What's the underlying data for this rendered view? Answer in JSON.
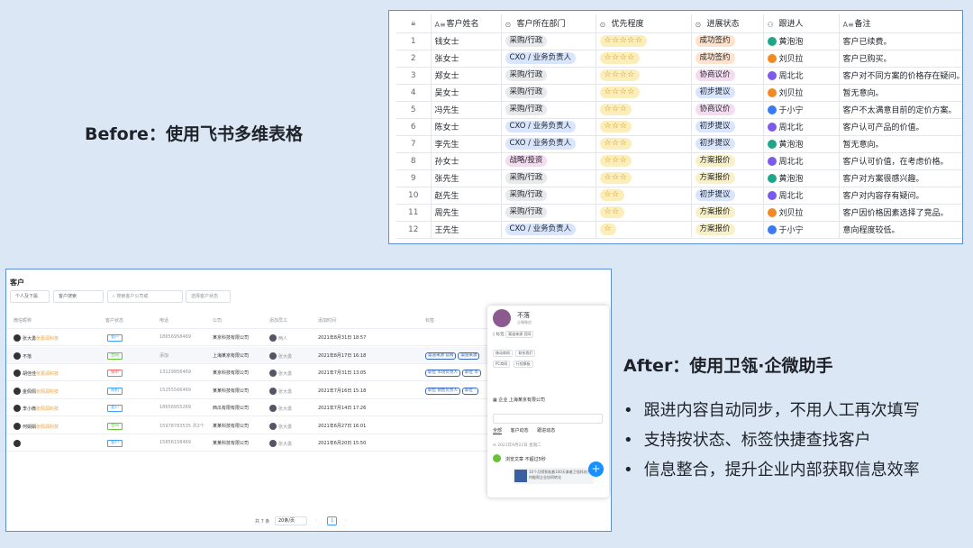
{
  "before": {
    "label": "Before：使用飞书多维表格",
    "columns": [
      "客户姓名",
      "客户所在部门",
      "优先程度",
      "进展状态",
      "跟进人",
      "备注"
    ],
    "rows": [
      {
        "n": "1",
        "name": "钱女士",
        "dept": "采购/行政",
        "stars": "☆☆☆☆☆",
        "status": "成功签约",
        "owner": "黄泡泡",
        "note": "客户已续费。"
      },
      {
        "n": "2",
        "name": "张女士",
        "dept": "CXO / 业务负责人",
        "stars": "☆☆☆☆",
        "status": "成功签约",
        "owner": "刘贝拉",
        "note": "客户已购买。"
      },
      {
        "n": "3",
        "name": "郑女士",
        "dept": "采购/行政",
        "stars": "☆☆☆☆",
        "status": "协商议价",
        "owner": "周北北",
        "note": "客户对不同方案的价格存在疑问。"
      },
      {
        "n": "4",
        "name": "吴女士",
        "dept": "采购/行政",
        "stars": "☆☆☆☆",
        "status": "初步提议",
        "owner": "刘贝拉",
        "note": "暂无意向。"
      },
      {
        "n": "5",
        "name": "冯先生",
        "dept": "采购/行政",
        "stars": "☆☆☆",
        "status": "协商议价",
        "owner": "于小宁",
        "note": "客户不太满意目前的定价方案。"
      },
      {
        "n": "6",
        "name": "陈女士",
        "dept": "CXO / 业务负责人",
        "stars": "☆☆☆",
        "status": "初步提议",
        "owner": "周北北",
        "note": "客户认可产品的价值。"
      },
      {
        "n": "7",
        "name": "李先生",
        "dept": "CXO / 业务负责人",
        "stars": "☆☆☆",
        "status": "初步提议",
        "owner": "黄泡泡",
        "note": "暂无意向。"
      },
      {
        "n": "8",
        "name": "孙女士",
        "dept": "战略/投资",
        "stars": "☆☆☆",
        "status": "方案报价",
        "owner": "周北北",
        "note": "客户认可价值，在考虑价格。"
      },
      {
        "n": "9",
        "name": "张先生",
        "dept": "采购/行政",
        "stars": "☆☆☆",
        "status": "方案报价",
        "owner": "黄泡泡",
        "note": "客户对方案很感兴趣。"
      },
      {
        "n": "10",
        "name": "赵先生",
        "dept": "采购/行政",
        "stars": "☆☆",
        "status": "初步提议",
        "owner": "周北北",
        "note": "客户对内容存有疑问。"
      },
      {
        "n": "11",
        "name": "周先生",
        "dept": "采购/行政",
        "stars": "☆☆",
        "status": "方案报价",
        "owner": "刘贝拉",
        "note": "客户因价格因素选择了竞品。"
      },
      {
        "n": "12",
        "name": "王先生",
        "dept": "CXO / 业务负责人",
        "stars": "☆",
        "status": "方案报价",
        "owner": "于小宁",
        "note": "意向程度较低。"
      }
    ]
  },
  "after": {
    "label": "After：使用卫瓴·企微助手",
    "bullets": [
      "跟进内容自动同步，不用人工再次填写",
      "支持按状态、标签快捷查找客户",
      "信息整合，提升企业内部获取信息效率"
    ],
    "screen": {
      "title": "客户",
      "filters": [
        "个人及下属",
        "客户搜索",
        "搜索客户公司或",
        "选择客户状态"
      ],
      "columns": [
        "微信昵称",
        "客户状态",
        "电话",
        "公司",
        "添加员工",
        "添加时间",
        "标签"
      ],
      "rows": [
        {
          "name": "张大勇",
          "tag": "张嘉润科技",
          "status": "客户",
          "phone": "18656958469",
          "company": "某京科技有限公司",
          "staff": "两人",
          "time": "2021年8月31日 18:57",
          "labels": []
        },
        {
          "name": "不落",
          "tag": "",
          "status": "合同",
          "phone": "添加",
          "company": "上海某京有限公司",
          "staff": "张大勇",
          "time": "2021年8月17日 16:18",
          "labels": [
            "渠道来源 官网",
            "渠道来源"
          ]
        },
        {
          "name": "胡佳佳",
          "tag": "张嘉润科技",
          "status": "报单",
          "phone": "13129956469",
          "company": "某京科技有限公司",
          "staff": "张大勇",
          "time": "2021年7月31日 13:05",
          "labels": [
            "职位 市场负责人",
            "职位 市"
          ]
        },
        {
          "name": "金佩佩",
          "tag": "张佩润科技",
          "status": "商机",
          "phone": "15255566469",
          "company": "某某科技有限公司",
          "staff": "张大勇",
          "time": "2021年7月16日 15:18",
          "labels": [
            "职位 销售负责人",
            "职位 -"
          ]
        },
        {
          "name": "李小微",
          "tag": "张佩润科技",
          "status": "客户",
          "phone": "18656955269",
          "company": "西瓜有限有限公司",
          "staff": "张大勇",
          "time": "2021年7月14日 17:26",
          "labels": []
        },
        {
          "name": "何娟娟",
          "tag": "张佩润科技",
          "status": "合同",
          "phone": "15978783535 共2个",
          "company": "某某科技有限公司",
          "staff": "张大勇",
          "time": "2021年6月27日 16:01",
          "labels": []
        },
        {
          "name": "",
          "tag": "",
          "status": "客户",
          "phone": "15856158469",
          "company": "某某科技有限公司",
          "staff": "张大勇",
          "time": "2021年6月20日 15:50",
          "labels": []
        }
      ],
      "pager": {
        "total": "共 7 条",
        "size": "20条/页",
        "page": "1"
      },
      "panel": {
        "name": "不落",
        "sub": "企微微信",
        "tags": [
          "渠道来源 官网"
        ],
        "lines": [
          "移动商网",
          "联系我们",
          "PC商网",
          "行程模板"
        ],
        "company": "上海某京有限公司",
        "tabs": [
          "全部",
          "客户动态",
          "跟进动态"
        ],
        "date": "2021年9月22日 星期二",
        "feed": "浏览文章 不超过5秒",
        "card": "10个月得到粘着100天拿着卫瓴科技为何能帮企业协同转化"
      }
    }
  }
}
